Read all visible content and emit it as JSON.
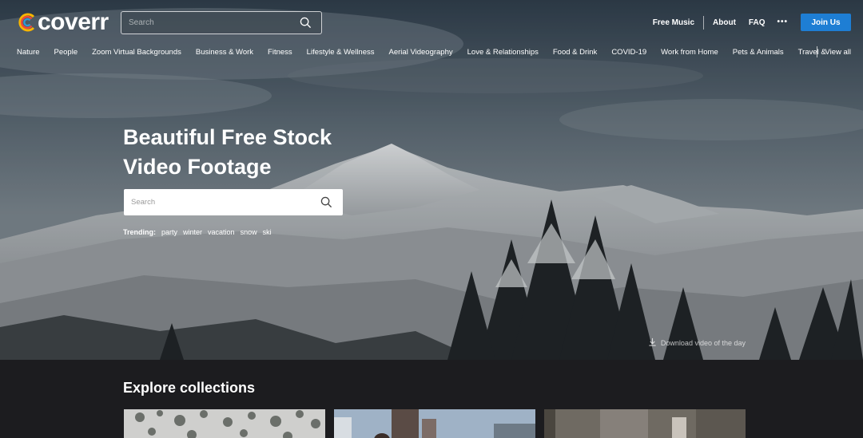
{
  "brand": {
    "name": "coverr",
    "logo_colors": [
      "#f7b500",
      "#e94b3c",
      "#2e9bd6",
      "#4cbf6a"
    ]
  },
  "header": {
    "search_placeholder": "Search",
    "links": {
      "free_music": "Free Music",
      "about": "About",
      "faq": "FAQ",
      "more": "•••"
    },
    "join_label": "Join Us",
    "accent_color": "#1e7ed4"
  },
  "categories": [
    "Nature",
    "People",
    "Zoom Virtual Backgrounds",
    "Business & Work",
    "Fitness",
    "Lifestyle & Wellness",
    "Aerial Videography",
    "Love & Relationships",
    "Food & Drink",
    "COVID-19",
    "Work from Home",
    "Pets & Animals",
    "Travel &"
  ],
  "view_all": "View all",
  "hero": {
    "title_line1": "Beautiful Free Stock",
    "title_line2": "Video Footage",
    "search_placeholder": "Search",
    "trending_label": "Trending:",
    "trending_tags": [
      "party",
      "winter",
      "vacation",
      "snow",
      "ski"
    ],
    "download_label": "Download video of the day"
  },
  "explore": {
    "title": "Explore collections"
  },
  "icons": {
    "search": "search-icon",
    "download": "download-icon",
    "more": "more-dots-icon"
  }
}
